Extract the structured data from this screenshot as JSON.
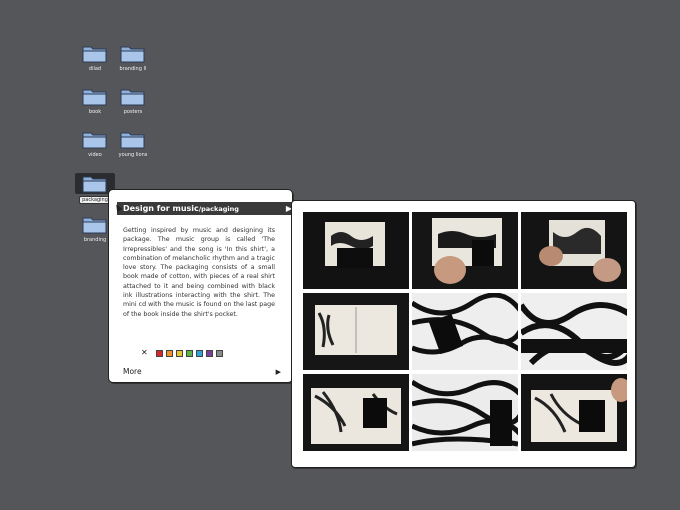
{
  "desktop": {
    "folders": [
      {
        "label": "dilad"
      },
      {
        "label": "branding II"
      },
      {
        "label": "book"
      },
      {
        "label": "posters"
      },
      {
        "label": "video"
      },
      {
        "label": "young lions"
      },
      {
        "label": "packaging",
        "selected": true
      },
      {
        "label": "branding"
      }
    ]
  },
  "info_panel": {
    "title": "Design for music",
    "subtitle": "/packaging",
    "description": "Getting inspired by music and designing its package. The music group is called 'The Irrepressibles' and the song is 'In this shirt', a combination of melancholic rhythm and a tragic love story. The packaging consists of a small book made of cotton, with pieces of a real shirt attached to it and being combined with black ink illustrations interacting with the shirt. The mini cd with the music is found on the last page of the book inside the shirt's pocket.",
    "close_symbol": "✕",
    "play_symbol": "▶",
    "swatches": [
      "#d8262c",
      "#f2912a",
      "#e8c531",
      "#5bb346",
      "#2ea3d8",
      "#7a3f9a",
      "#8a8a8a"
    ],
    "more_label": "More",
    "more_arrow": "▶"
  },
  "gallery": {
    "thumbnail_count": 9
  }
}
